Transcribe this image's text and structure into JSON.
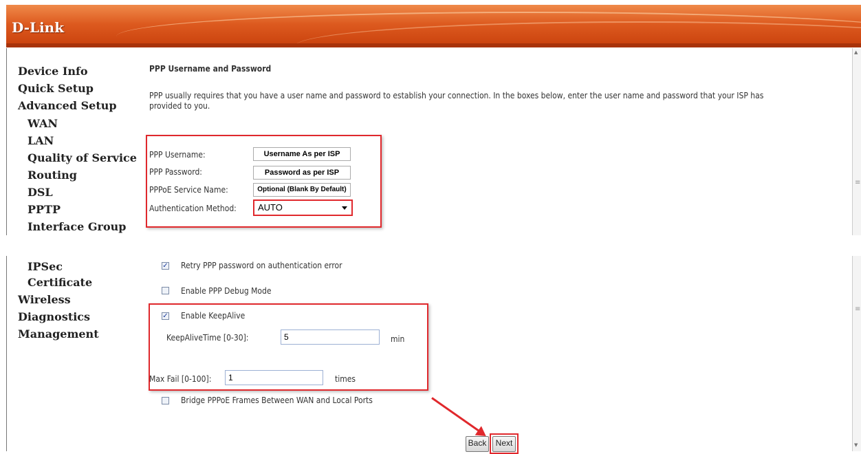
{
  "brand": "D-Link",
  "nav": {
    "top_items": [
      "Device Info",
      "Quick Setup",
      "Advanced Setup"
    ],
    "advanced_sub_items": [
      "WAN",
      "LAN",
      "Quality of Service",
      "Routing",
      "DSL",
      "PPTP",
      "Interface Group"
    ],
    "second_sub_items": [
      "IPSec",
      "Certificate"
    ],
    "bottom_items": [
      "Wireless",
      "Diagnostics",
      "Management"
    ]
  },
  "section": {
    "title": "PPP Username and Password",
    "description_line1": "PPP usually requires that you have a user name and password to establish your connection. In the boxes below, enter the user name and password that your ISP has",
    "description_line2": "provided to you."
  },
  "form": {
    "username_label": "PPP Username:",
    "username_value": "Username As per ISP",
    "password_label": "PPP Password:",
    "password_value": "Password as per ISP",
    "service_label": "PPPoE Service Name:",
    "service_value": "Optional (Blank By Default)",
    "auth_label": "Authentication Method:",
    "auth_value": "AUTO"
  },
  "options": {
    "retry_label": "Retry PPP password on authentication error",
    "retry_checked": true,
    "debug_label": "Enable PPP Debug Mode",
    "debug_checked": false,
    "keepalive_label": "Enable KeepAlive",
    "keepalive_checked": true,
    "keepalive_time_label": "KeepAliveTime [0-30]:",
    "keepalive_time_value": "5",
    "keepalive_time_unit": "min",
    "max_fail_label": "Max Fail [0-100]:",
    "max_fail_value": "1",
    "max_fail_unit": "times",
    "bridge_label": "Bridge PPPoE Frames Between WAN and Local Ports",
    "bridge_checked": false
  },
  "buttons": {
    "back": "Back",
    "next": "Next"
  },
  "colors": {
    "banner": "#dd5a1f",
    "highlight": "#e0282c"
  }
}
